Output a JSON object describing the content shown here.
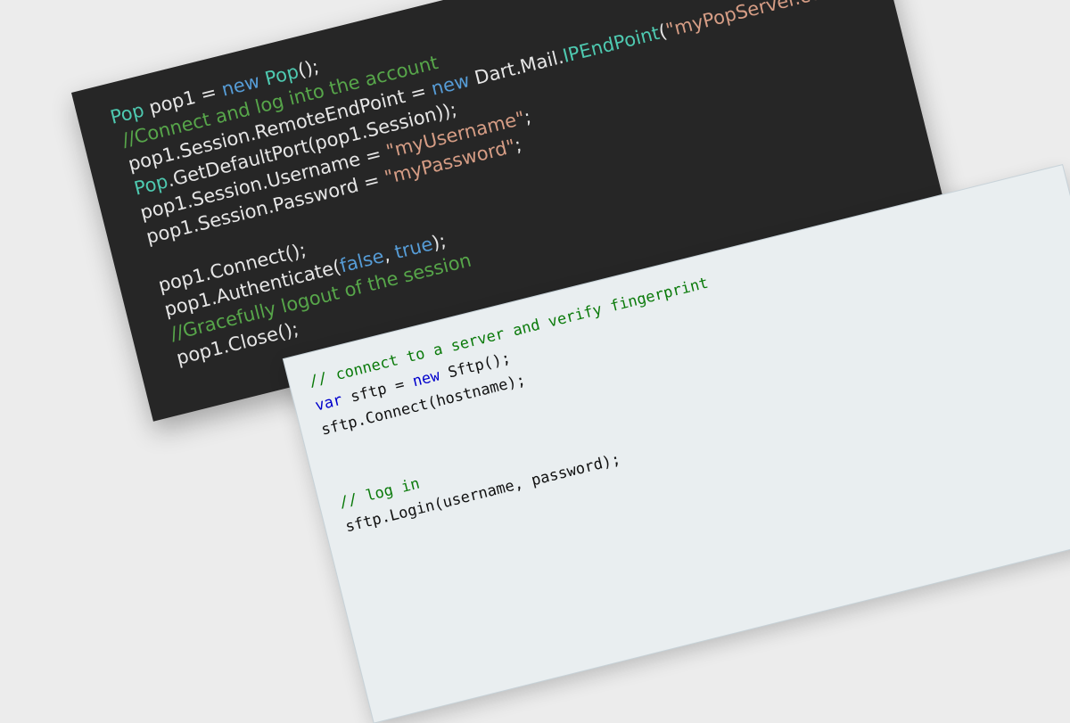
{
  "dark_code": {
    "lines": [
      [
        {
          "t": "Pop",
          "c": "type"
        },
        {
          "t": " pop1 = ",
          "c": "plain"
        },
        {
          "t": "new",
          "c": "kw"
        },
        {
          "t": " ",
          "c": "plain"
        },
        {
          "t": "Pop",
          "c": "type"
        },
        {
          "t": "();",
          "c": "plain"
        }
      ],
      [
        {
          "t": " //Connect and log into the account",
          "c": "comment"
        }
      ],
      [
        {
          "t": " pop1.Session.RemoteEndPoint = ",
          "c": "plain"
        },
        {
          "t": "new",
          "c": "kw"
        },
        {
          "t": " Dart.Mail.",
          "c": "plain"
        },
        {
          "t": "IPEndPoint",
          "c": "type"
        },
        {
          "t": "(",
          "c": "plain"
        },
        {
          "t": "\"myPopServer.com\"",
          "c": "str"
        },
        {
          "t": ",",
          "c": "plain"
        }
      ],
      [
        {
          "t": " ",
          "c": "plain"
        },
        {
          "t": "Pop",
          "c": "type"
        },
        {
          "t": ".GetDefaultPort(pop1.Session));",
          "c": "plain"
        }
      ],
      [
        {
          "t": " pop1.Session.Username = ",
          "c": "plain"
        },
        {
          "t": "\"myUsername\"",
          "c": "str"
        },
        {
          "t": ";",
          "c": "plain"
        }
      ],
      [
        {
          "t": " pop1.Session.Password = ",
          "c": "plain"
        },
        {
          "t": "\"myPassword\"",
          "c": "str"
        },
        {
          "t": ";",
          "c": "plain"
        }
      ],
      [],
      [
        {
          "t": " pop1.Connect();",
          "c": "plain"
        }
      ],
      [
        {
          "t": " pop1.Authenticate(",
          "c": "plain"
        },
        {
          "t": "false",
          "c": "kw"
        },
        {
          "t": ", ",
          "c": "plain"
        },
        {
          "t": "true",
          "c": "kw"
        },
        {
          "t": ");",
          "c": "plain"
        }
      ],
      [
        {
          "t": " //Gracefully logout of the session",
          "c": "comment"
        }
      ],
      [
        {
          "t": " pop1.Close();",
          "c": "plain"
        }
      ]
    ]
  },
  "light_code": {
    "lines": [
      [
        {
          "t": "// connect to a server and verify fingerprint",
          "c": "comment"
        }
      ],
      [
        {
          "t": "var",
          "c": "kw"
        },
        {
          "t": " sftp = ",
          "c": "plain"
        },
        {
          "t": "new",
          "c": "kw"
        },
        {
          "t": " Sftp();",
          "c": "plain"
        }
      ],
      [
        {
          "t": "sftp.Connect(hostname);",
          "c": "plain"
        }
      ],
      [],
      [],
      [
        {
          "t": "// log in",
          "c": "comment"
        }
      ],
      [
        {
          "t": "sftp.Login(username, password);",
          "c": "plain"
        }
      ]
    ]
  },
  "colors": {
    "background": "#ececec",
    "dark_card": "#262626",
    "light_card": "#e9eef0",
    "dark_type": "#4ec9b0",
    "dark_keyword": "#569cd6",
    "dark_comment": "#57a64a",
    "dark_string": "#d69d85",
    "light_comment": "#0a7a0a",
    "light_keyword": "#0000cc"
  }
}
